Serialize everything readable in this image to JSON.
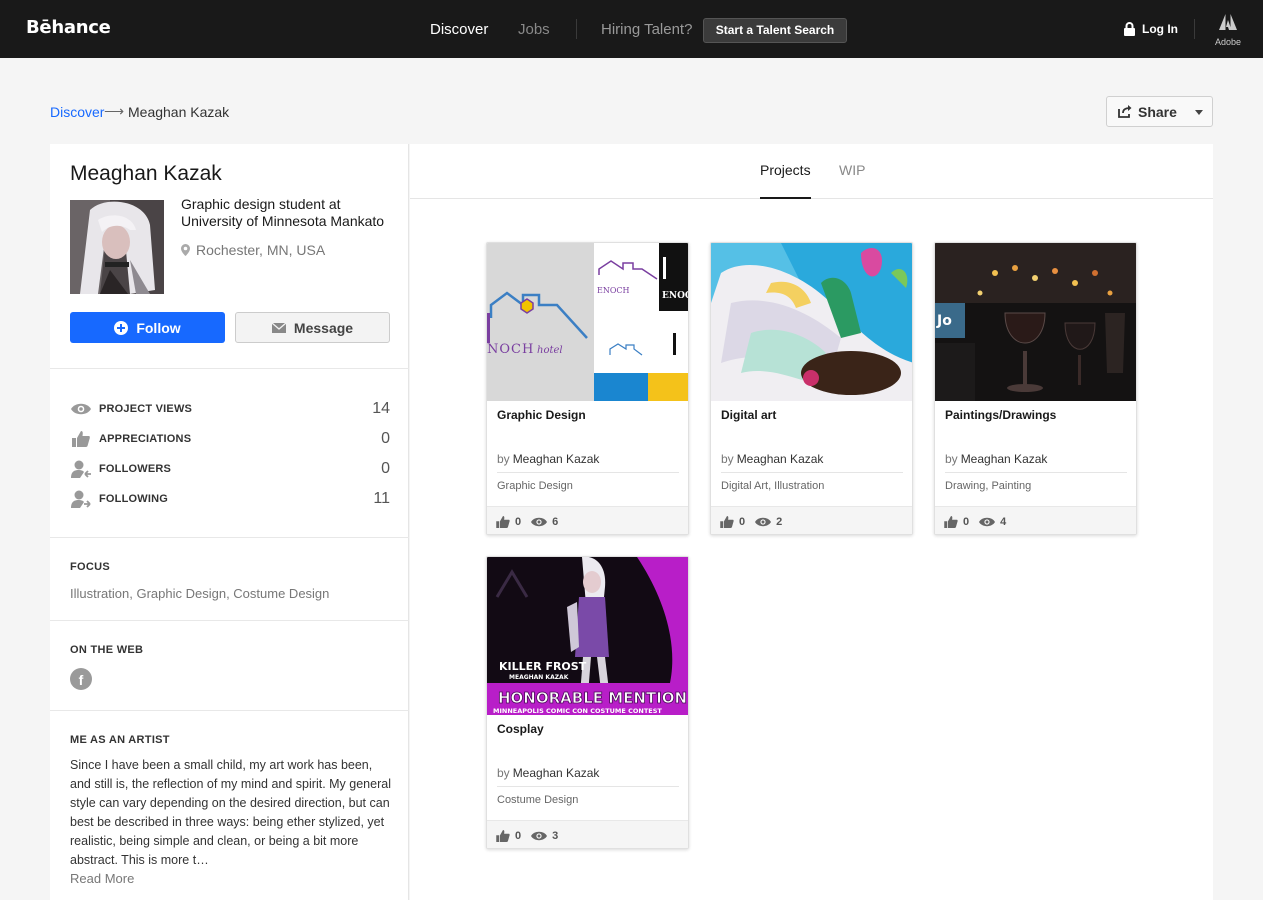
{
  "nav": {
    "logo": "Bēhance",
    "discover": "Discover",
    "jobs": "Jobs",
    "hiring": "Hiring Talent?",
    "talent_search": "Start a Talent Search",
    "login": "Log In",
    "adobe": "Adobe"
  },
  "breadcrumb": {
    "discover": "Discover",
    "arrow": "⟶",
    "current": "Meaghan Kazak"
  },
  "share": {
    "label": "Share"
  },
  "profile": {
    "name": "Meaghan Kazak",
    "bio": "Graphic design student at University of Minnesota Mankato",
    "location": "Rochester, MN, USA",
    "follow": "Follow",
    "message": "Message",
    "stats": [
      {
        "label": "PROJECT VIEWS",
        "value": "14",
        "icon": "eye-icon"
      },
      {
        "label": "APPRECIATIONS",
        "value": "0",
        "icon": "thumbs-up-icon"
      },
      {
        "label": "FOLLOWERS",
        "value": "0",
        "icon": "followers-icon"
      },
      {
        "label": "FOLLOWING",
        "value": "11",
        "icon": "following-icon"
      }
    ],
    "focus_heading": "FOCUS",
    "focus": "Illustration, Graphic Design, Costume Design",
    "web_heading": "ON THE WEB",
    "artist_heading": "ME AS AN ARTIST",
    "artist_text": "Since I have been a small child, my art work has been, and still is, the reflection of my mind and spirit. My general style can vary depending on the desired direction, but can best be described in three ways: being ether stylized, yet realistic, being simple and clean, or being a bit more abstract. This is more t…",
    "read_more": "Read More"
  },
  "tabs": {
    "projects": "Projects",
    "wip": "WIP"
  },
  "projects": [
    {
      "title": "Graphic Design",
      "by": "by",
      "author": "Meaghan Kazak",
      "fields": "Graphic Design",
      "appreciations": "0",
      "views": "6"
    },
    {
      "title": "Digital art",
      "by": "by",
      "author": "Meaghan Kazak",
      "fields": "Digital Art, Illustration",
      "appreciations": "0",
      "views": "2"
    },
    {
      "title": "Paintings/Drawings",
      "by": "by",
      "author": "Meaghan Kazak",
      "fields": "Drawing, Painting",
      "appreciations": "0",
      "views": "4"
    },
    {
      "title": "Cosplay",
      "by": "by",
      "author": "Meaghan Kazak",
      "fields": "Costume Design",
      "appreciations": "0",
      "views": "3"
    }
  ],
  "cover_text": {
    "enoch": "NOCH",
    "enoch_small": "ENOCH",
    "hotel": "hotel",
    "killer_frost": "KILLER FROST",
    "cosplay_name": "MEAGHAN KAZAK",
    "honorable": "HONORABLE MENTION",
    "contest": "MINNEAPOLIS COMIC CON COSTUME CONTEST"
  },
  "colors": {
    "brand_blue": "#1769ff",
    "nav_bg": "#191919",
    "page_bg": "#f5f5f5"
  }
}
